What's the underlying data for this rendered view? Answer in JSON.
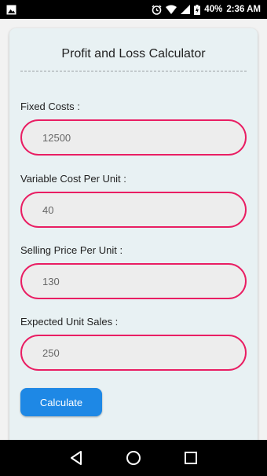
{
  "status_bar": {
    "battery_percent": "40%",
    "time": "2:36 AM",
    "icons": [
      "image-notification-icon",
      "alarm-icon",
      "wifi-icon",
      "signal-icon",
      "battery-charging-icon"
    ]
  },
  "app": {
    "title": "Profit and Loss Calculator",
    "fields": [
      {
        "label": "Fixed Costs :",
        "value": "12500"
      },
      {
        "label": "Variable Cost Per Unit :",
        "value": "40"
      },
      {
        "label": "Selling Price Per Unit :",
        "value": "130"
      },
      {
        "label": "Expected Unit Sales :",
        "value": "250"
      }
    ],
    "calculate_label": "Calculate"
  },
  "colors": {
    "accent_input_border": "#e91e63",
    "button": "#1e88e5",
    "card_background": "#e8f1f3"
  },
  "nav_bar": {
    "icons": [
      "back-icon",
      "home-icon",
      "recents-icon"
    ]
  }
}
